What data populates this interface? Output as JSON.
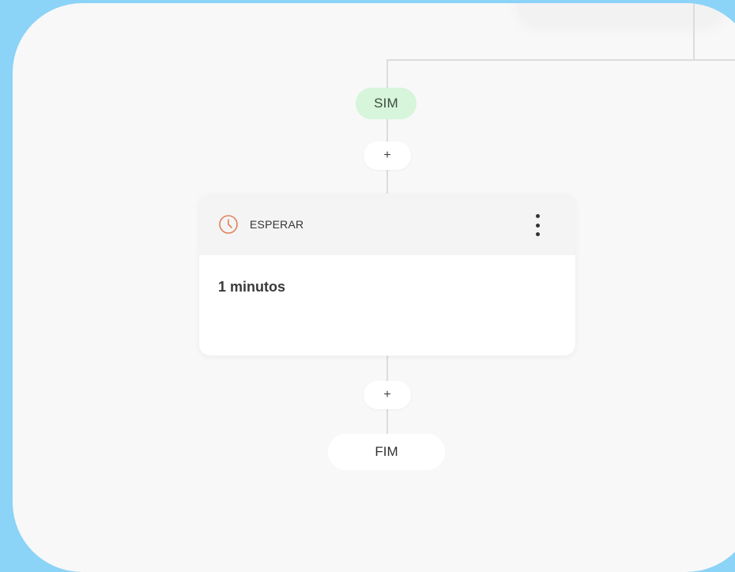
{
  "branch": {
    "label": "SIM",
    "color": "#d6f5da"
  },
  "add_step": {
    "label": "+"
  },
  "wait_step": {
    "title": "ESPERAR",
    "icon": "clock-icon",
    "icon_color": "#e0825a",
    "value": "1 minutos"
  },
  "end": {
    "label": "FIM"
  }
}
